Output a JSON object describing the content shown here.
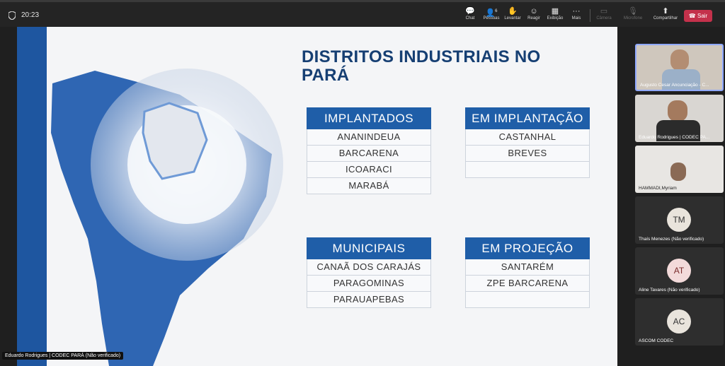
{
  "meeting": {
    "time": "20:23",
    "toolbar": {
      "chat": "Chat",
      "people": "Pessoas",
      "people_count": "6",
      "raise": "Levantar",
      "react": "Reagir",
      "view": "Exibição",
      "more": "Mais",
      "camera": "Câmera",
      "mic": "Microfone",
      "share": "Compartilhar",
      "leave": "Sair"
    },
    "accent_color": "#c4314b"
  },
  "slide": {
    "title_line1": "DISTRITOS INDUSTRIAIS NO",
    "title_line2": "PARÁ",
    "tables": [
      {
        "header": "IMPLANTADOS",
        "rows": [
          "ANANINDEUA",
          "BARCARENA",
          "ICOARACI",
          "MARABÁ"
        ]
      },
      {
        "header": "EM IMPLANTAÇÃO",
        "rows": [
          "CASTANHAL",
          "BREVES",
          ""
        ]
      },
      {
        "header": "MUNICIPAIS",
        "rows": [
          "CANAÃ DOS CARAJÁS",
          "PARAGOMINAS",
          "PARAUAPEBAS"
        ]
      },
      {
        "header": "EM PROJEÇÃO",
        "rows": [
          "SANTARÉM",
          "ZPE BARCARENA",
          ""
        ]
      }
    ],
    "brand_color": "#1f5ea8"
  },
  "participants": [
    {
      "name": "Augusto Cesar Ancunciação - C...",
      "initials": ""
    },
    {
      "name": "Eduardo Rodrigues | CODEC PA...",
      "initials": ""
    },
    {
      "name": "HAMMADI,Myriam",
      "initials": ""
    },
    {
      "name": "Thaís Menezes (Não verificado)",
      "initials": "TM"
    },
    {
      "name": "Aline Tavares (Não verificado)",
      "initials": "AT"
    },
    {
      "name": "ASCOM CODEC",
      "initials": "AC"
    }
  ],
  "presenter_label": "Eduardo Rodrigues | CODEC PARÁ (Não verificado)"
}
